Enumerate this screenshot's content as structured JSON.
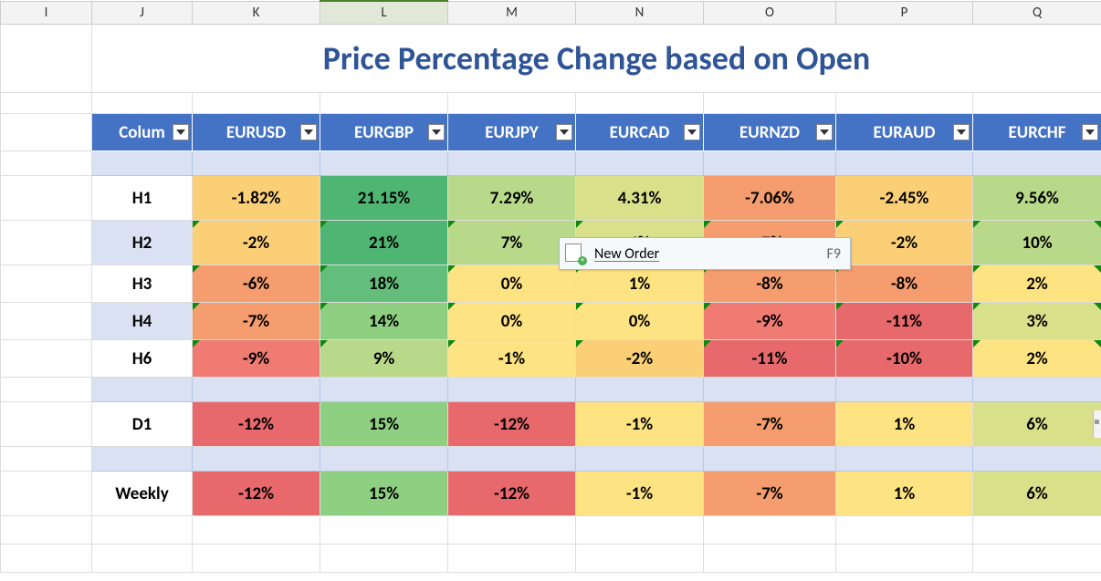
{
  "columns": [
    "I",
    "J",
    "K",
    "L",
    "M",
    "N",
    "O",
    "P",
    "Q"
  ],
  "active_column_index": 3,
  "title": "Price Percentage Change based on Open",
  "headers": [
    "Colum",
    "EURUSD",
    "EURGBP",
    "EURJPY",
    "EURCAD",
    "EURNZD",
    "EURAUD",
    "EURCHF"
  ],
  "rows": [
    {
      "label": "H1",
      "alt": false,
      "tall": true,
      "flags": false,
      "cells": [
        {
          "v": "-1.82%",
          "c": "g-yorng"
        },
        {
          "v": "21.15%",
          "c": "g-dgreen2"
        },
        {
          "v": "7.29%",
          "c": "g-lgreen"
        },
        {
          "v": "4.31%",
          "c": "g-ygreen"
        },
        {
          "v": "-7.06%",
          "c": "g-ored"
        },
        {
          "v": "-2.45%",
          "c": "g-yorng"
        },
        {
          "v": "9.56%",
          "c": "g-lgreen"
        }
      ]
    },
    {
      "label": "H2",
      "alt": true,
      "tall": true,
      "flags": true,
      "cells": [
        {
          "v": "-2%",
          "c": "g-yorng"
        },
        {
          "v": "21%",
          "c": "g-dgreen2"
        },
        {
          "v": "7%",
          "c": "g-lgreen"
        },
        {
          "v": "4%",
          "c": "g-ygreen"
        },
        {
          "v": "-7%",
          "c": "g-ored"
        },
        {
          "v": "-2%",
          "c": "g-yorng"
        },
        {
          "v": "10%",
          "c": "g-lgreen"
        }
      ]
    },
    {
      "label": "H3",
      "alt": false,
      "tall": false,
      "flags": true,
      "cells": [
        {
          "v": "-6%",
          "c": "g-ored"
        },
        {
          "v": "18%",
          "c": "g-dgreen"
        },
        {
          "v": "0%",
          "c": "g-yellow"
        },
        {
          "v": "1%",
          "c": "g-yellow"
        },
        {
          "v": "-8%",
          "c": "g-ored"
        },
        {
          "v": "-8%",
          "c": "g-ored"
        },
        {
          "v": "2%",
          "c": "g-yellow"
        }
      ]
    },
    {
      "label": "H4",
      "alt": true,
      "tall": false,
      "flags": true,
      "cells": [
        {
          "v": "-7%",
          "c": "g-ored"
        },
        {
          "v": "14%",
          "c": "g-green"
        },
        {
          "v": "0%",
          "c": "g-yellow"
        },
        {
          "v": "0%",
          "c": "g-yellow"
        },
        {
          "v": "-9%",
          "c": "g-red"
        },
        {
          "v": "-11%",
          "c": "g-dred"
        },
        {
          "v": "3%",
          "c": "g-ygreen"
        }
      ]
    },
    {
      "label": "H6",
      "alt": false,
      "tall": false,
      "flags": true,
      "cells": [
        {
          "v": "-9%",
          "c": "g-red"
        },
        {
          "v": "9%",
          "c": "g-lgreen"
        },
        {
          "v": "-1%",
          "c": "g-yellow"
        },
        {
          "v": "-2%",
          "c": "g-yorng"
        },
        {
          "v": "-11%",
          "c": "g-dred"
        },
        {
          "v": "-10%",
          "c": "g-dred"
        },
        {
          "v": "2%",
          "c": "g-yellow"
        }
      ]
    }
  ],
  "d_row": {
    "label": "D1",
    "alt": false,
    "tall": true,
    "flags": false,
    "cells": [
      {
        "v": "-12%",
        "c": "g-dred"
      },
      {
        "v": "15%",
        "c": "g-green"
      },
      {
        "v": "-12%",
        "c": "g-dred"
      },
      {
        "v": "-1%",
        "c": "g-yellow"
      },
      {
        "v": "-7%",
        "c": "g-ored"
      },
      {
        "v": "1%",
        "c": "g-yellow"
      },
      {
        "v": "6%",
        "c": "g-ygreen"
      }
    ]
  },
  "w_row": {
    "label": "Weekly",
    "alt": false,
    "tall": true,
    "flags": false,
    "cells": [
      {
        "v": "-12%",
        "c": "g-dred"
      },
      {
        "v": "15%",
        "c": "g-green"
      },
      {
        "v": "-12%",
        "c": "g-dred"
      },
      {
        "v": "-1%",
        "c": "g-yellow"
      },
      {
        "v": "-7%",
        "c": "g-ored"
      },
      {
        "v": "1%",
        "c": "g-yellow"
      },
      {
        "v": "6%",
        "c": "g-ygreen"
      }
    ]
  },
  "context_menu": {
    "label": "New Order",
    "shortcut": "F9"
  },
  "chart_data": {
    "type": "table",
    "title": "Price Percentage Change based on Open",
    "columns": [
      "EURUSD",
      "EURGBP",
      "EURJPY",
      "EURCAD",
      "EURNZD",
      "EURAUD",
      "EURCHF"
    ],
    "rows": [
      "H1",
      "H2",
      "H3",
      "H4",
      "H6",
      "D1",
      "Weekly"
    ],
    "values": [
      [
        -1.82,
        21.15,
        7.29,
        4.31,
        -7.06,
        -2.45,
        9.56
      ],
      [
        -2,
        21,
        7,
        4,
        -7,
        -2,
        10
      ],
      [
        -6,
        18,
        0,
        1,
        -8,
        -8,
        2
      ],
      [
        -7,
        14,
        0,
        0,
        -9,
        -11,
        3
      ],
      [
        -9,
        9,
        -1,
        -2,
        -11,
        -10,
        2
      ],
      [
        -12,
        15,
        -12,
        -1,
        -7,
        1,
        6
      ],
      [
        -12,
        15,
        -12,
        -1,
        -7,
        1,
        6
      ]
    ],
    "unit": "percent"
  }
}
